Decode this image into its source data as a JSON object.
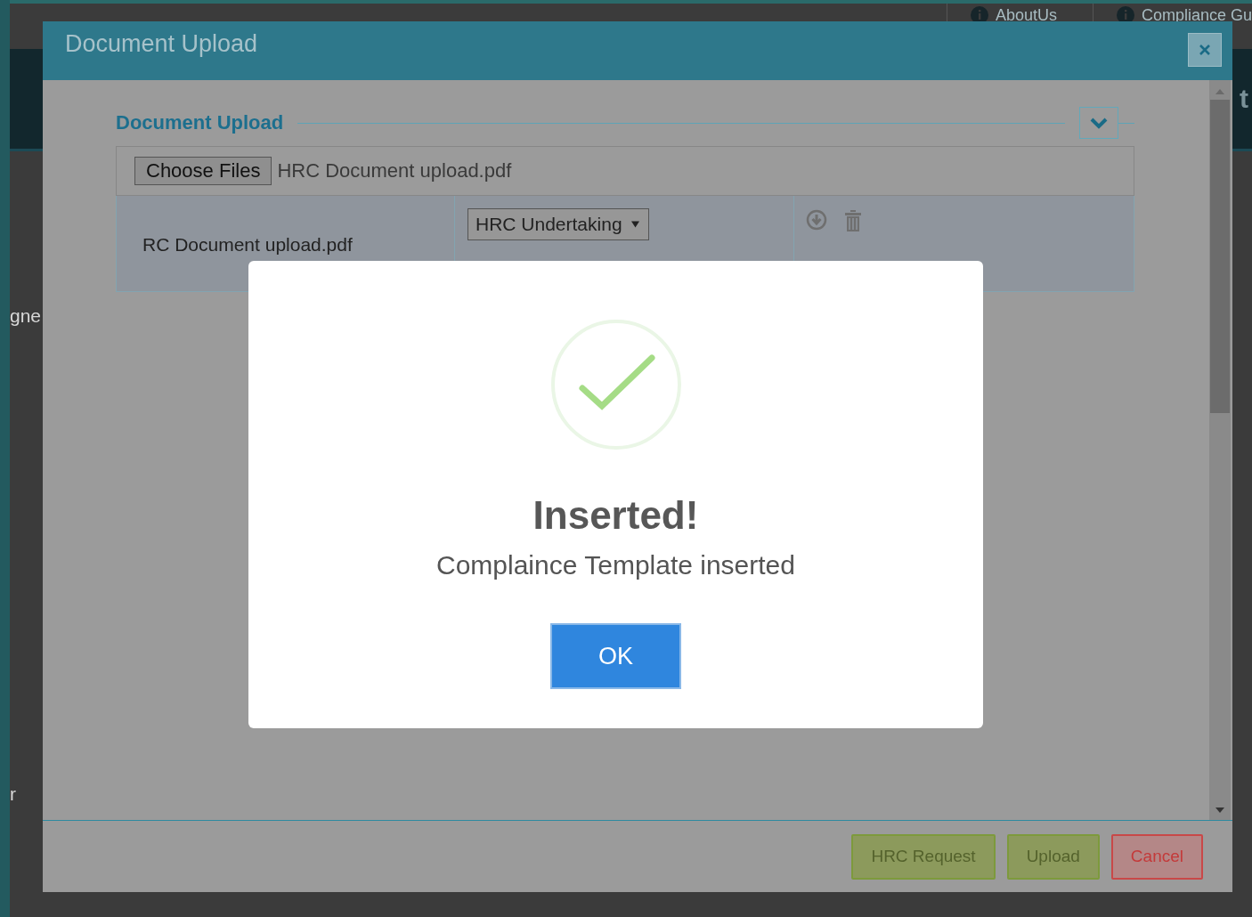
{
  "background": {
    "nav": [
      {
        "label": "AboutUs"
      },
      {
        "label": "Compliance Gu"
      }
    ],
    "side_texts": [
      "gne",
      "r"
    ],
    "edge_text": "t"
  },
  "modal": {
    "title": "Document Upload",
    "section_title": "Document Upload",
    "file_input": {
      "button": "Choose Files",
      "value": "HRC Document upload.pdf"
    },
    "files": [
      {
        "name": "RC Document upload.pdf",
        "type": "HRC Undertaking"
      }
    ],
    "buttons": [
      {
        "label": "HRC Request",
        "kind": "request"
      },
      {
        "label": "Upload",
        "kind": "upload"
      },
      {
        "label": "Cancel",
        "kind": "cancel"
      }
    ]
  },
  "alert": {
    "kind": "success",
    "title": "Inserted!",
    "message": "Complaince Template inserted",
    "button": "OK"
  }
}
